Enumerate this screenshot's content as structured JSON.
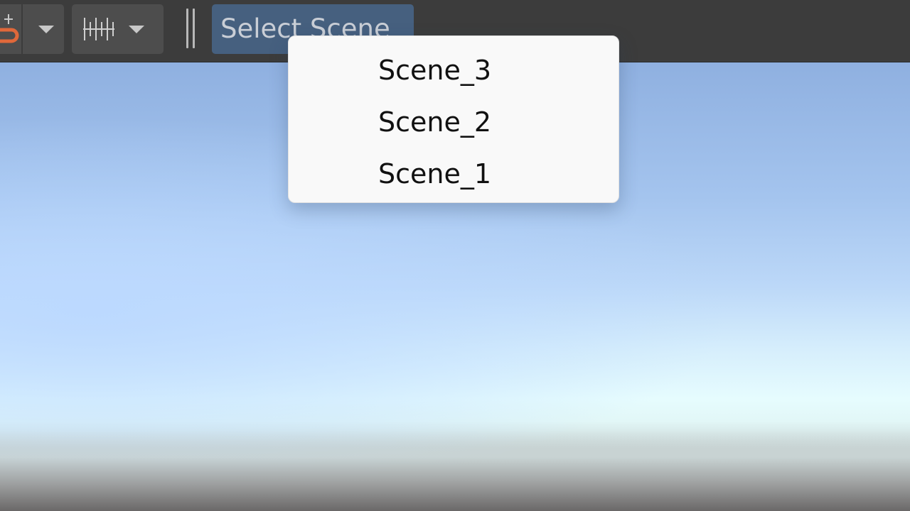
{
  "toolbar": {
    "snap_tool": {
      "icon": "snap-magnet-icon",
      "dropdown_icon": "chevron-down-icon"
    },
    "grid_tool": {
      "icon": "grid-snapping-icon",
      "dropdown_icon": "chevron-down-icon"
    },
    "divider_icon": "toolbar-divider-icon",
    "select_scene": {
      "label": "Select Scene"
    }
  },
  "scene_menu": {
    "items": [
      {
        "label": "Scene_3"
      },
      {
        "label": "Scene_2"
      },
      {
        "label": "Scene_1"
      }
    ]
  },
  "colors": {
    "toolbar_bg": "#3c3c3c",
    "tool_group_bg": "#4d4d4d",
    "select_scene_bg": "#46607f",
    "menu_bg": "#f9f9f9",
    "snap_icon_accent": "#e0683a"
  }
}
